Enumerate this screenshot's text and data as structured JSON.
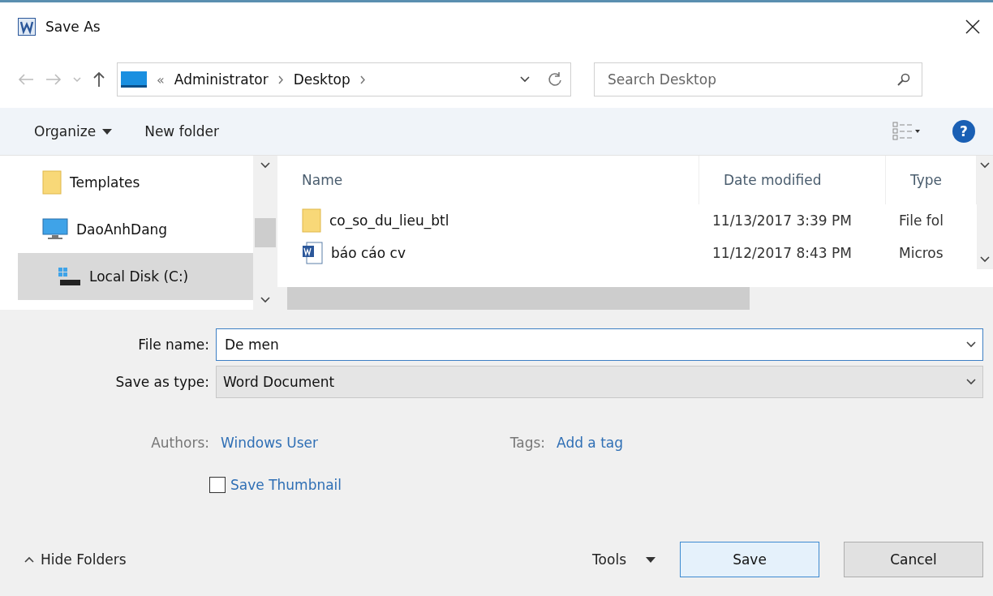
{
  "window": {
    "title": "Save As"
  },
  "address": {
    "overflow": "«",
    "crumbs": [
      "Administrator",
      "Desktop"
    ]
  },
  "search": {
    "placeholder": "Search Desktop"
  },
  "toolbar": {
    "organize": "Organize",
    "new_folder": "New folder",
    "help": "?"
  },
  "nav": [
    {
      "label": "Templates",
      "kind": "folder",
      "selected": false
    },
    {
      "label": "DaoAnhDang",
      "kind": "computer",
      "selected": false
    },
    {
      "label": "Local Disk (C:)",
      "kind": "disk",
      "selected": true
    }
  ],
  "table": {
    "columns": [
      "Name",
      "Date modified",
      "Type"
    ],
    "rows": [
      {
        "kind": "folder",
        "name": "co_so_du_lieu_btl",
        "date": "11/13/2017 3:39 PM",
        "type": "File fol"
      },
      {
        "kind": "word",
        "name": "báo cáo cv",
        "date": "11/12/2017 8:43 PM",
        "type": "Micros"
      }
    ]
  },
  "file_name": {
    "label": "File name:",
    "value": "De men"
  },
  "save_type": {
    "label": "Save as type:",
    "value": "Word Document"
  },
  "authors": {
    "label": "Authors:",
    "value": "Windows User"
  },
  "tags": {
    "label": "Tags:",
    "value": "Add a tag"
  },
  "thumbnail": {
    "label": "Save Thumbnail",
    "checked": false
  },
  "hide_folders": "Hide Folders",
  "tools": "Tools",
  "buttons": [
    "Save",
    "Cancel"
  ]
}
